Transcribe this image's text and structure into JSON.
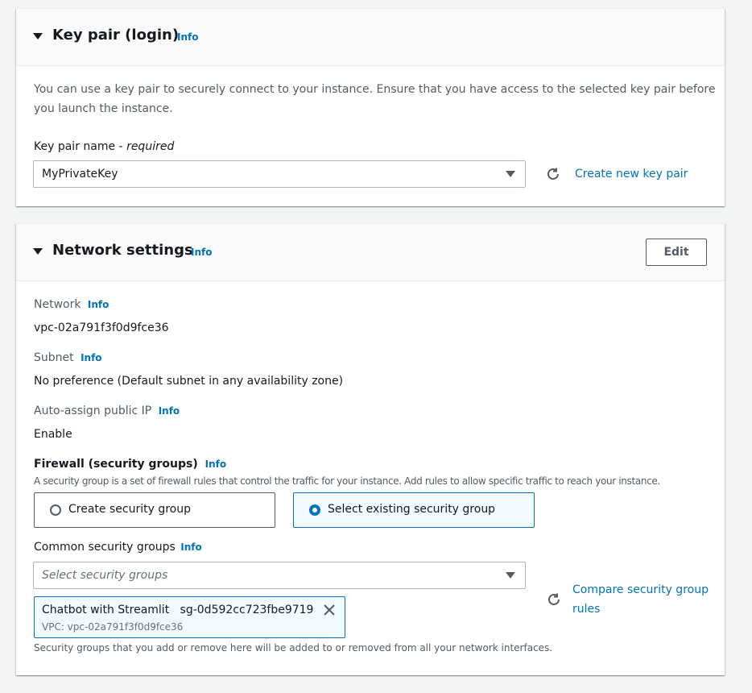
{
  "key_pair": {
    "title": "Key pair (login)",
    "info": "Info",
    "description_line1": "You can use a key pair to securely connect to your instance. Ensure that you have access to the selected key pair before",
    "description_line2": "you launch the instance.",
    "name_label": "Key pair name - ",
    "name_required": "required",
    "selected_value": "MyPrivateKey",
    "create_link": "Create new key pair"
  },
  "network": {
    "title": "Network settings",
    "info": "Info",
    "edit_button": "Edit",
    "network_label": "Network",
    "network_value": "vpc-02a791f3f0d9fce36",
    "subnet_label": "Subnet",
    "subnet_value": "No preference (Default subnet in any availability zone)",
    "public_ip_label": "Auto-assign public IP",
    "public_ip_value": "Enable",
    "firewall_label": "Firewall (security groups)",
    "firewall_description": "A security group is a set of firewall rules that control the traffic for your instance. Add rules to allow specific traffic to reach your instance.",
    "option_create": "Create security group",
    "option_select": "Select existing security group",
    "common_sg_label": "Common security groups",
    "sg_placeholder": "Select security groups",
    "token_name": "Chatbot with Streamlit",
    "token_id": "sg-0d592cc723fbe9719",
    "token_vpc": "VPC: vpc-02a791f3f0d9fce36",
    "compare_link_line1": "Compare security group",
    "compare_link_line2": "rules",
    "footer_note": "Security groups that you add or remove here will be added to or removed from all your network interfaces."
  },
  "icons": [
    "caret-down-icon",
    "refresh-icon",
    "close-icon",
    "dropdown-triangle-icon",
    "radio-icon"
  ],
  "colors": {
    "accent": "#0073bb",
    "text": "#16191f",
    "secondary_text": "#545b64",
    "selected_bg": "#f1faff"
  }
}
